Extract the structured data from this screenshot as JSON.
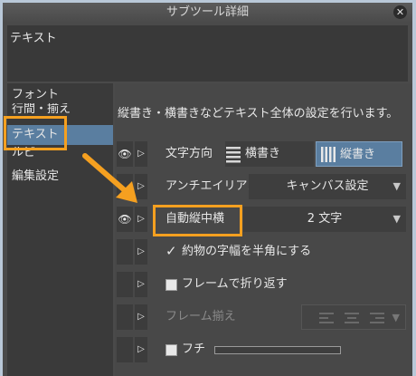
{
  "window": {
    "title": "サブツール詳細",
    "close_glyph": "✕"
  },
  "preview": {
    "text": "テキスト"
  },
  "sidebar": {
    "items": [
      {
        "label": "フォント"
      },
      {
        "label": "行間・揃え"
      },
      {
        "label": "テキスト"
      },
      {
        "label": "ルビ"
      },
      {
        "label": "編集設定"
      }
    ],
    "selected": "テキスト"
  },
  "panel": {
    "description": "縦書き・横書きなどテキスト全体の設定を行います。",
    "rows": [
      {
        "label": "文字方向",
        "option_a": "横書き",
        "option_b": "縦書き",
        "selected": "縦書き"
      },
      {
        "label": "アンチエイリアス",
        "value": "キャンバス設定"
      },
      {
        "label": "自動縦中横",
        "value": "2 文字"
      },
      {
        "label": "約物の字幅を半角にする",
        "checked": true
      },
      {
        "label": "フレームで折り返す",
        "checked": false
      },
      {
        "label": "フレーム揃え",
        "disabled": true
      },
      {
        "label": "フチ",
        "checked": false
      }
    ]
  },
  "icons": {
    "eye": "eye-icon",
    "expand": "expand-triangle-icon",
    "dropdown": "dropdown-arrow-icon"
  },
  "colors": {
    "highlight": "#f5a020",
    "selected": "#5a7ea0"
  }
}
